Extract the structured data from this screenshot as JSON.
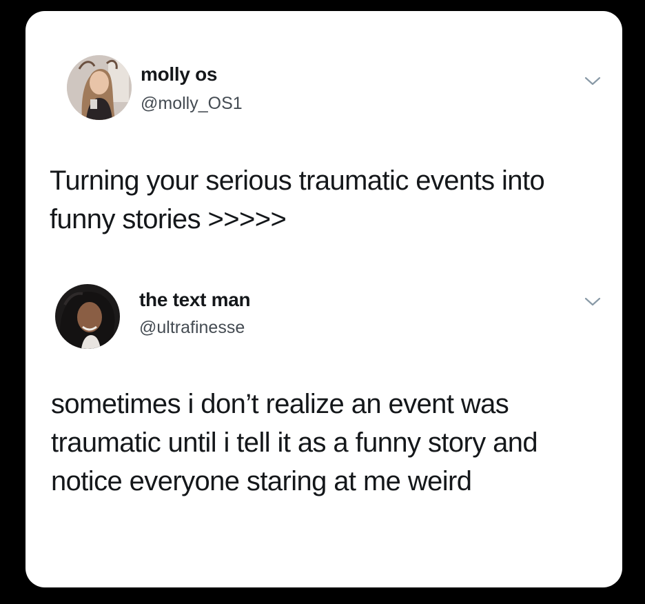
{
  "tweets": [
    {
      "display_name": "molly os",
      "handle": "@molly_OS1",
      "avatar_icon": "profile-photo",
      "menu_icon": "chevron-down-icon",
      "text": "Turning your serious traumatic events into funny stories >>>>>"
    },
    {
      "display_name": "the text man",
      "handle": "@ultrafinesse",
      "avatar_icon": "profile-photo",
      "menu_icon": "chevron-down-icon",
      "text": "sometimes i don’t realize an event was traumatic until i tell it as a funny story and notice everyone staring at me weird"
    }
  ],
  "colors": {
    "background": "#000000",
    "card": "#ffffff",
    "text": "#14171a",
    "handle": "#444b52",
    "chevron": "#8899a6"
  }
}
